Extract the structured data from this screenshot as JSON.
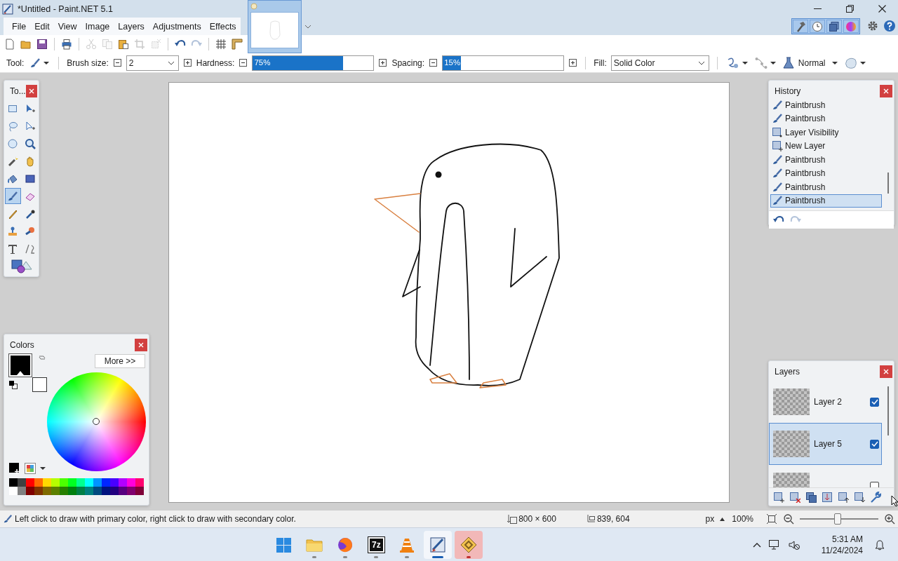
{
  "window": {
    "title": "*Untitled - Paint.NET 5.1"
  },
  "menu": [
    "File",
    "Edit",
    "View",
    "Image",
    "Layers",
    "Adjustments",
    "Effects"
  ],
  "image_tabs": [
    {
      "selected": true
    }
  ],
  "tool_window_toggles": [
    {
      "kind": "tools",
      "selected": true
    },
    {
      "kind": "history",
      "selected": true
    },
    {
      "kind": "layers",
      "selected": true
    },
    {
      "kind": "colors",
      "selected": true
    }
  ],
  "toolbar": [
    [
      {
        "kind": "new",
        "disabled": false
      },
      {
        "kind": "open",
        "disabled": false
      },
      {
        "kind": "save",
        "disabled": false
      }
    ],
    [
      {
        "kind": "print",
        "disabled": false
      }
    ],
    [
      {
        "kind": "cut",
        "disabled": true
      },
      {
        "kind": "copy",
        "disabled": true
      },
      {
        "kind": "paste",
        "disabled": false
      },
      {
        "kind": "crop",
        "disabled": true
      },
      {
        "kind": "deselect",
        "disabled": true
      }
    ],
    [
      {
        "kind": "undo",
        "disabled": false
      },
      {
        "kind": "redo",
        "disabled": true
      }
    ],
    [
      {
        "kind": "grid",
        "disabled": false
      },
      {
        "kind": "rulers",
        "disabled": false
      }
    ]
  ],
  "tool_options": {
    "tool_label": "Tool:",
    "brush_size_label": "Brush size:",
    "brush_size": "2",
    "hardness_label": "Hardness:",
    "hardness": {
      "level": 0.75,
      "reading": "75%"
    },
    "spacing_label": "Spacing:",
    "spacing": {
      "level": 0.15,
      "reading": "15%"
    },
    "fill_label": "Fill:",
    "fill": "Solid Color",
    "blend_mode": "Normal"
  },
  "tools_panel": {
    "title": "To...",
    "tools": [
      {
        "kind": "rectangle-select",
        "selected": false
      },
      {
        "kind": "move-selected",
        "selected": false
      },
      {
        "kind": "lasso",
        "selected": false
      },
      {
        "kind": "move-selection",
        "selected": false
      },
      {
        "kind": "ellipse-select",
        "selected": false
      },
      {
        "kind": "zoom",
        "selected": false
      },
      {
        "kind": "magic-wand",
        "selected": false
      },
      {
        "kind": "pan",
        "selected": false
      },
      {
        "kind": "paint-bucket",
        "selected": false
      },
      {
        "kind": "gradient",
        "selected": false
      },
      {
        "kind": "paintbrush",
        "selected": true
      },
      {
        "kind": "eraser",
        "selected": false
      },
      {
        "kind": "pencil",
        "selected": false
      },
      {
        "kind": "color-picker",
        "selected": false
      },
      {
        "kind": "clone-stamp",
        "selected": false
      },
      {
        "kind": "recolor",
        "selected": false
      },
      {
        "kind": "text",
        "selected": false
      },
      {
        "kind": "line-curve",
        "selected": false
      },
      {
        "kind": "shapes",
        "selected": false
      }
    ]
  },
  "history": {
    "title": "History",
    "items": [
      {
        "kind": "paintbrush",
        "label": "Paintbrush",
        "selected": false
      },
      {
        "kind": "paintbrush",
        "label": "Paintbrush",
        "selected": false
      },
      {
        "kind": "layer-visibility",
        "label": "Layer Visibility",
        "selected": false
      },
      {
        "kind": "new-layer",
        "label": "New Layer",
        "selected": false
      },
      {
        "kind": "paintbrush",
        "label": "Paintbrush",
        "selected": false
      },
      {
        "kind": "paintbrush",
        "label": "Paintbrush",
        "selected": false
      },
      {
        "kind": "paintbrush",
        "label": "Paintbrush",
        "selected": false
      },
      {
        "kind": "paintbrush",
        "label": "Paintbrush",
        "selected": true
      }
    ]
  },
  "layers": {
    "title": "Layers",
    "items": [
      {
        "name": "Layer 2",
        "visible": true,
        "selected": false
      },
      {
        "name": "Layer 5",
        "visible": true,
        "selected": true
      },
      {
        "visible": false,
        "selected": false
      }
    ]
  },
  "colors": {
    "title": "Colors",
    "more_button": "More >>",
    "swatches": [
      {
        "kind": "secondary",
        "color": "#ffffff"
      },
      {
        "kind": "primary",
        "color": "#000000"
      }
    ],
    "palette": [
      [
        {
          "color": "#000000"
        },
        {
          "color": "#404040"
        },
        {
          "color": "#ff0000"
        },
        {
          "color": "#ff6a00"
        },
        {
          "color": "#ffd800"
        },
        {
          "color": "#b6ff00"
        },
        {
          "color": "#4cff00"
        },
        {
          "color": "#00ff21"
        },
        {
          "color": "#00ff90"
        },
        {
          "color": "#00ffff"
        },
        {
          "color": "#0094ff"
        },
        {
          "color": "#0026ff"
        },
        {
          "color": "#4800ff"
        },
        {
          "color": "#b200ff"
        },
        {
          "color": "#ff00dc"
        },
        {
          "color": "#ff006e"
        }
      ],
      [
        {
          "color": "#ffffff"
        },
        {
          "color": "#808080"
        },
        {
          "color": "#7f0000"
        },
        {
          "color": "#7f3300"
        },
        {
          "color": "#7f6a00"
        },
        {
          "color": "#5b7f00"
        },
        {
          "color": "#267f00"
        },
        {
          "color": "#007f0e"
        },
        {
          "color": "#007f46"
        },
        {
          "color": "#007f7f"
        },
        {
          "color": "#004a7f"
        },
        {
          "color": "#00137f"
        },
        {
          "color": "#21007f"
        },
        {
          "color": "#57007f"
        },
        {
          "color": "#7f006e"
        },
        {
          "color": "#7f0037"
        }
      ]
    ]
  },
  "status_bar": {
    "hint": "Left click to draw with primary color, right click to draw with secondary color.",
    "image_size": "800 × 600",
    "cursor_position": "839, 604",
    "units": "px",
    "zoom": "100%",
    "zoom_slider": {
      "level": 0.48
    }
  },
  "taskbar": {
    "apps": [
      {
        "kind": "start",
        "selected": false
      },
      {
        "kind": "file-explorer",
        "running": true,
        "selected": false
      },
      {
        "kind": "firefox",
        "running": true,
        "selected": false
      },
      {
        "kind": "archiver",
        "label": "7z",
        "running": true,
        "selected": false
      },
      {
        "kind": "vlc",
        "running": true,
        "selected": false
      },
      {
        "kind": "paint",
        "running": true,
        "selected": true
      },
      {
        "kind": "app",
        "running": true,
        "selected": false,
        "hovered": true
      }
    ],
    "time": "5:31 AM",
    "date": "11/24/2024"
  }
}
